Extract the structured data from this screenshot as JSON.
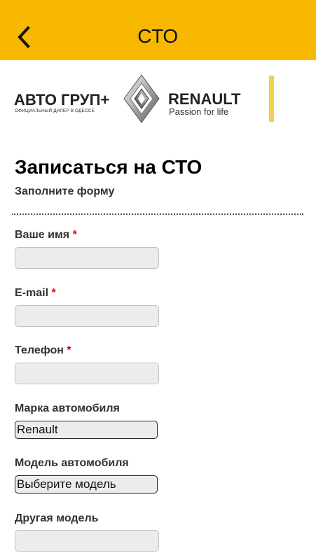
{
  "appbar": {
    "title": "СТО",
    "back_icon": "chevron-left-icon",
    "background": "#f8b800"
  },
  "banner": {
    "dealer_name": "АВТО ГРУП+",
    "dealer_subtitle": "ОФИЦИАЛЬНЫЙ ДИЛЕР В ОДЕССЕ",
    "brand_name": "RENAULT",
    "brand_tagline": "Passion for life",
    "logo_icon": "renault-diamond-logo",
    "accent_bar_color": "#f3cf4e"
  },
  "form": {
    "title": "Записаться на СТО",
    "subtitle": "Заполните форму",
    "required_marker": "*",
    "fields": {
      "name": {
        "label": "Ваше имя",
        "value": "",
        "placeholder": ""
      },
      "email": {
        "label": "E-mail",
        "value": "",
        "placeholder": ""
      },
      "phone": {
        "label": "Телефон",
        "value": "",
        "placeholder": ""
      },
      "car_brand": {
        "label": "Марка автомобиля",
        "selected": "Renault"
      },
      "car_model": {
        "label": "Модель автомобиля",
        "selected": "Выберите модель"
      },
      "other_model": {
        "label": "Другая модель",
        "value": "",
        "placeholder": ""
      }
    }
  }
}
